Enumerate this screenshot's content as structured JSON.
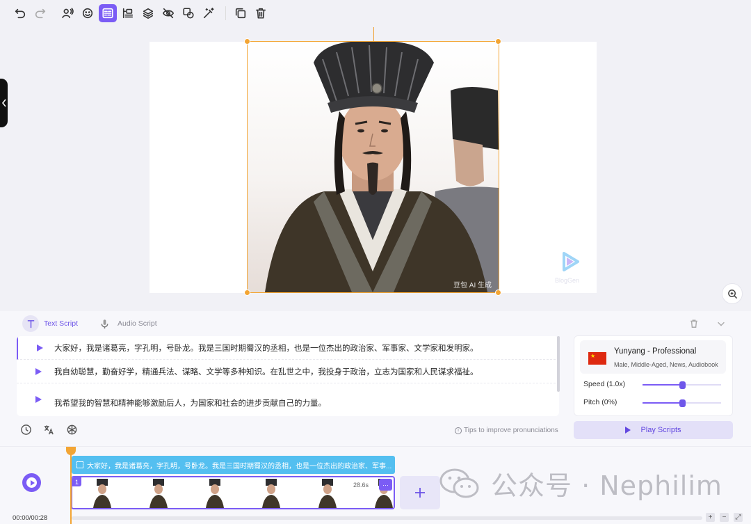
{
  "toolbar": {
    "buttons": [
      {
        "icon": "undo-icon"
      },
      {
        "icon": "redo-icon"
      },
      {
        "icon": "avatar-person-icon"
      },
      {
        "icon": "sticker-emoji-icon"
      },
      {
        "icon": "subtitle-icon",
        "active": true
      },
      {
        "icon": "align-icon"
      },
      {
        "icon": "layers-icon"
      },
      {
        "icon": "hide-eye-icon"
      },
      {
        "icon": "shapes-icon"
      },
      {
        "icon": "magic-wand-icon"
      },
      {
        "icon": "duplicate-icon"
      },
      {
        "icon": "delete-icon"
      }
    ]
  },
  "canvas": {
    "image_watermark": "豆包 AI 生成",
    "logo_text": "BlogGen"
  },
  "script_panel": {
    "tabs": [
      {
        "label": "Text Script",
        "active": true
      },
      {
        "label": "Audio Script",
        "active": false
      }
    ],
    "lines": [
      "大家好，我是诸葛亮，字孔明，号卧龙。我是三国时期蜀汉的丞相，也是一位杰出的政治家、军事家、文学家和发明家。",
      "我自幼聪慧，勤奋好学，精通兵法、谋略、文学等多种知识。在乱世之中，我投身于政治，立志为国家和人民谋求福祉。",
      "我希望我的智慧和精神能够激励后人，为国家和社会的进步贡献自己的力量。"
    ],
    "tips": "Tips to improve pronunciations",
    "voice": {
      "name": "Yunyang - Professional",
      "description": "Male, Middle-Aged, News, Audiobook",
      "speed_label": "Speed (1.0x)",
      "speed_value": 0.5,
      "pitch_label": "Pitch (0%)",
      "pitch_value": 0.5
    },
    "play_scripts_label": "Play Scripts"
  },
  "timeline": {
    "current_time": "00:00/00:28",
    "caption_text": "大家好，我是诸葛亮，字孔明，号卧龙。我是三国时期蜀汉的丞相，也是一位杰出的政治家、军事...",
    "clip_number": "1",
    "clip_duration": "28.6s",
    "clip_more": "···",
    "zoom_in": "+",
    "zoom_out": "−",
    "fit": "⤢"
  },
  "brand_watermark": "公众号 · Nephilim",
  "colors": {
    "accent": "#7b5cf5",
    "selection": "#f3a534",
    "caption": "#54bff0"
  }
}
